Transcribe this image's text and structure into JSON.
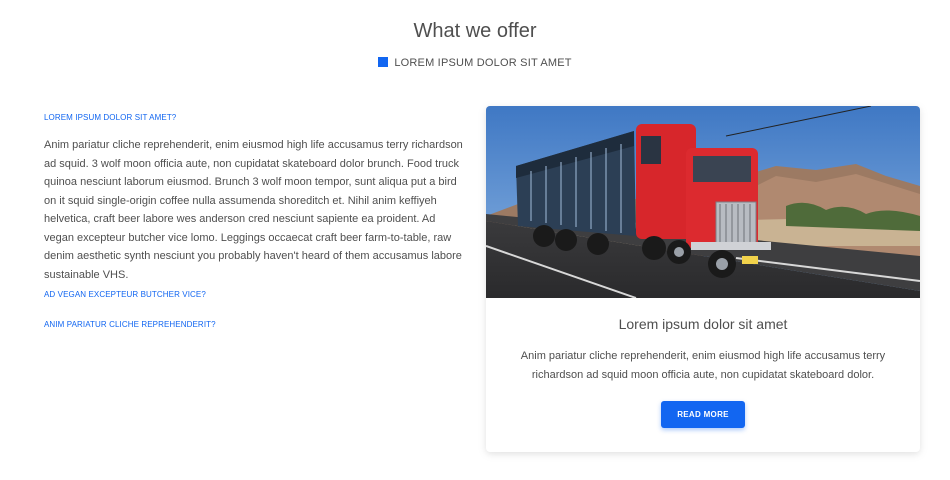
{
  "header": {
    "title": "What we offer",
    "subtitle": "LOREM IPSUM DOLOR SIT AMET",
    "accent_color": "#1266f1"
  },
  "faq": {
    "question_1": "LOREM IPSUM DOLOR SIT AMET?",
    "answer_1": "Anim pariatur cliche reprehenderit, enim eiusmod high life accusamus terry richardson ad squid. 3 wolf moon officia aute, non cupidatat skateboard dolor brunch. Food truck quinoa nesciunt laborum eiusmod. Brunch 3 wolf moon tempor, sunt aliqua put a bird on it squid single-origin coffee nulla assumenda shoreditch et. Nihil anim keffiyeh helvetica, craft beer labore wes anderson cred nesciunt sapiente ea proident. Ad vegan excepteur butcher vice lomo. Leggings occaecat craft beer farm-to-table, raw denim aesthetic synth nesciunt you probably haven't heard of them accusamus labore sustainable VHS.",
    "question_2": "AD VEGAN EXCEPTEUR BUTCHER VICE?",
    "question_3": "ANIM PARIATUR CLICHE REPREHENDERIT?"
  },
  "card": {
    "image": "red-semi-truck-on-desert-highway",
    "title": "Lorem ipsum dolor sit amet",
    "text": "Anim pariatur cliche reprehenderit, enim eiusmod high life accusamus terry richardson ad squid moon officia aute, non cupidatat skateboard dolor.",
    "button_label": "READ MORE"
  }
}
